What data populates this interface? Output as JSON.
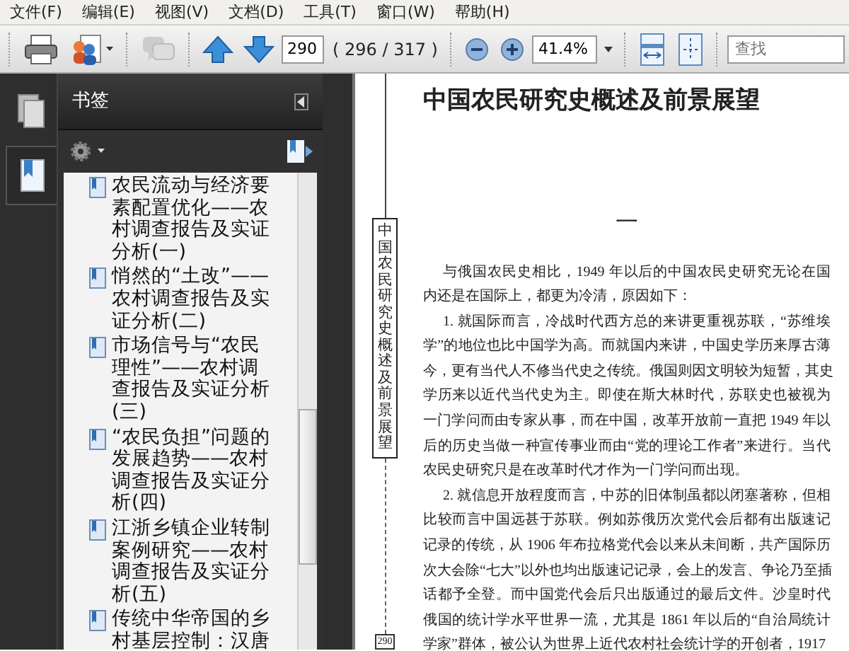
{
  "menu": [
    "文件(F)",
    "编辑(E)",
    "视图(V)",
    "文档(D)",
    "工具(T)",
    "窗口(W)",
    "帮助(H)"
  ],
  "toolbar": {
    "page_input": "290",
    "page_count": "( 296 / 317 )",
    "zoom": "41.4%",
    "search": {
      "placeholder": "查找"
    }
  },
  "sidebar": {
    "tabs": [
      {
        "kind": "pages",
        "selected": false
      },
      {
        "kind": "bookmarks",
        "selected": true
      }
    ]
  },
  "bookmarks_panel": {
    "title": "书签",
    "items": [
      "农民流动与经济要素配置优化——农村调查报告及实证分析(一)",
      "悄然的“土改”——农村调查报告及实证分析(二)",
      "市场信号与“农民理性”——农村调查报告及实证分析(三)",
      "“农民负担”问题的发展趋势——农村调查报告及实证分析(四)",
      "江浙乡镇企业转制案例研究——农村调查报告及实证分析(五)",
      "传统中华帝国的乡村基层控制：汉唐"
    ]
  },
  "document": {
    "spine_label": "中国农民研究史概述及前景展望",
    "title": "中国农民研究史概述及前景展望",
    "section": "一",
    "paragraphs": [
      {
        "lines": [
          "与俄国农民史相比，1949 年以后的中国农民史研究无论在国",
          "内还是在国际上，都更为冷清，原因如下："
        ]
      },
      {
        "lines": [
          "1. 就国际而言，冷战时代西方总的来讲更重视苏联，“苏维埃",
          "学”的地位也比中国学为高。而就国内来讲，中国史学历来厚古薄",
          "今，更有当代人不修当代史之传统。俄国则因文明较为短暂，其史",
          "学历来以近代当代史为主。即使在斯大林时代，苏联史也被视为",
          "一门学问而由专家从事，而在中国，改革开放前一直把 1949 年以",
          "后的历史当做一种宣传事业而由“党的理论工作者”来进行。当代",
          "农民史研究只是在改革时代才作为一门学问而出现。"
        ]
      },
      {
        "lines": [
          "2. 就信息开放程度而言，中苏的旧体制虽都以闭塞著称，但相",
          "比较而言中国远甚于苏联。例如苏俄历次党代会后都有出版速记",
          "记录的传统，从 1906 年布拉格党代会以来从未间断，共产国际历",
          "次大会除“七大”以外也均出版速记记录，会上的发言、争论乃至插",
          "话都予全登。而中国党代会后只出版通过的最后文件。沙皇时代",
          "俄国的统计学水平世界一流，尤其是 1861 年以后的“自治局统计",
          "学家”群体，被公认为世界上近代农村社会统计学的开创者，1917"
        ]
      }
    ],
    "page_number": "290"
  }
}
